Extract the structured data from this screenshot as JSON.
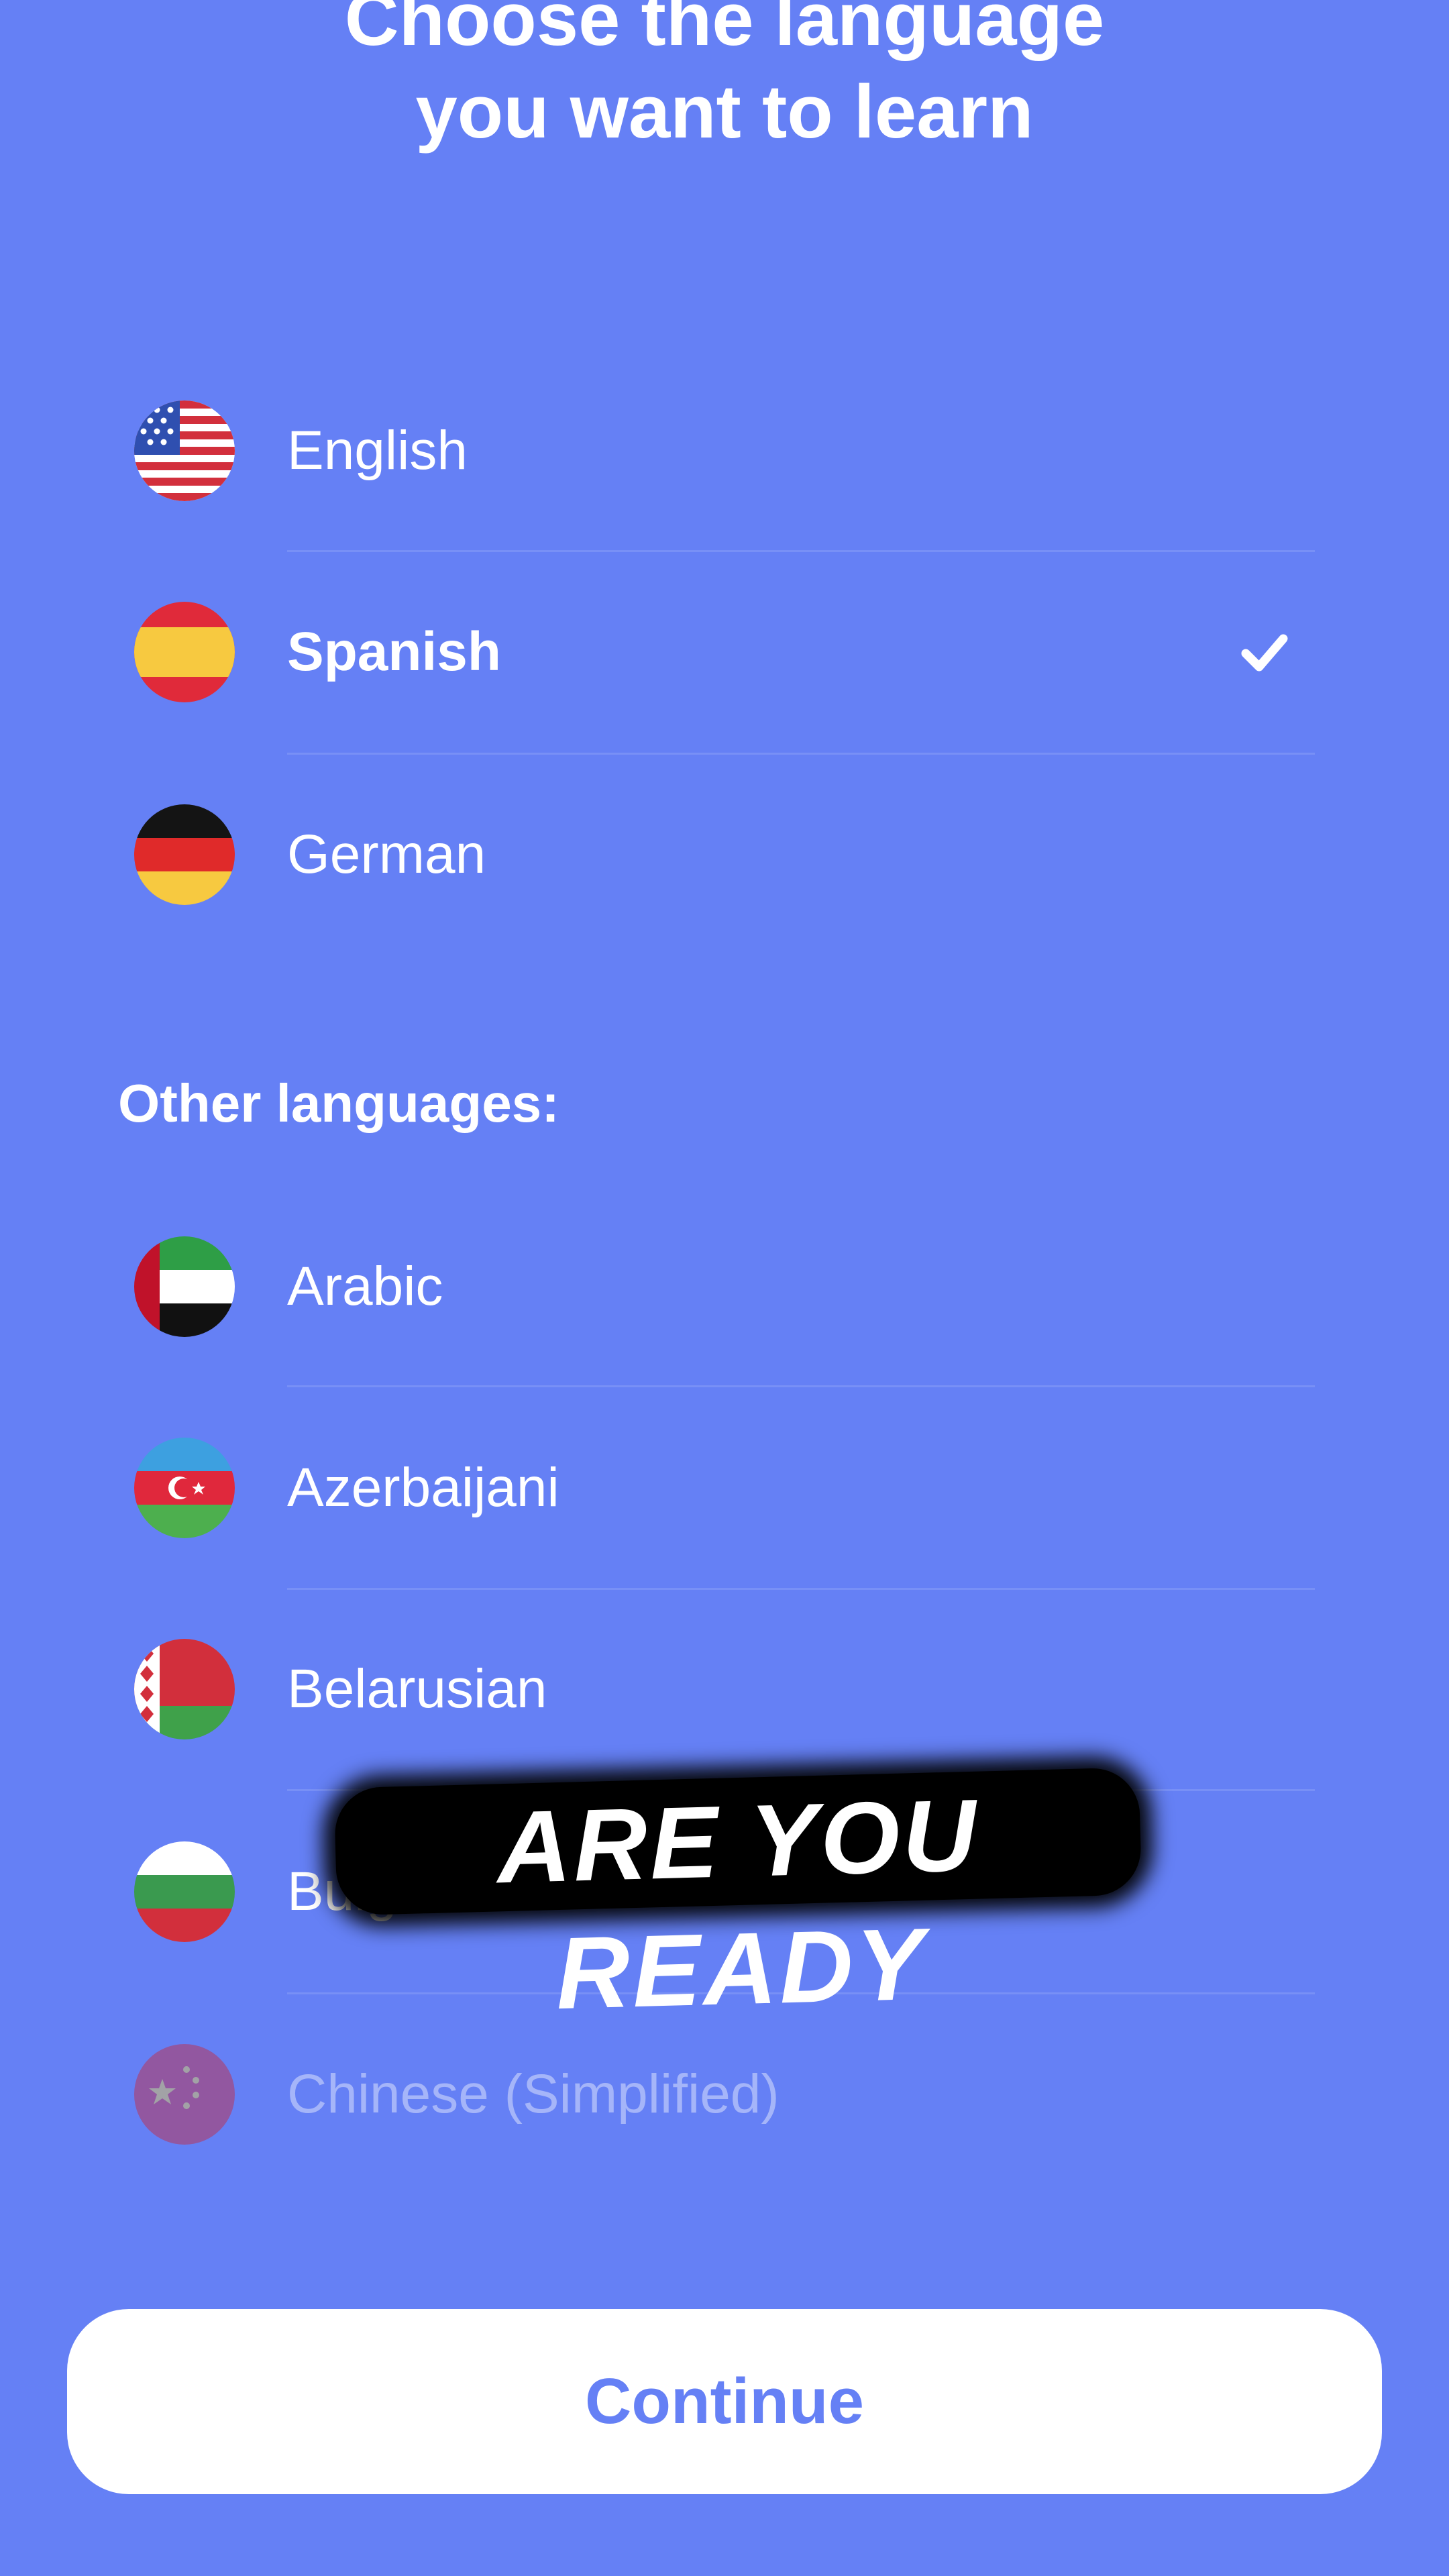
{
  "header": {
    "title_line1": "Choose the language",
    "title_line2": "you want to learn"
  },
  "popular_languages": [
    {
      "label": "English",
      "flag": "us-flag-icon",
      "selected": false
    },
    {
      "label": "Spanish",
      "flag": "spain-flag-icon",
      "selected": true
    },
    {
      "label": "German",
      "flag": "germany-flag-icon",
      "selected": false
    }
  ],
  "other_section": {
    "title": "Other languages:"
  },
  "other_languages": [
    {
      "label": "Arabic",
      "flag": "uae-flag-icon"
    },
    {
      "label": "Azerbaijani",
      "flag": "azerbaijan-flag-icon"
    },
    {
      "label": "Belarusian",
      "flag": "belarus-flag-icon"
    },
    {
      "label": "Bulgarian",
      "flag": "bulgaria-flag-icon"
    },
    {
      "label": "Chinese (Simplified)",
      "flag": "china-flag-icon"
    }
  ],
  "overlay": {
    "caption": "ARE YOU READY"
  },
  "footer": {
    "continue_label": "Continue"
  },
  "colors": {
    "background": "#6580F5",
    "button_text": "#6580F5",
    "text": "#FFFFFF"
  }
}
